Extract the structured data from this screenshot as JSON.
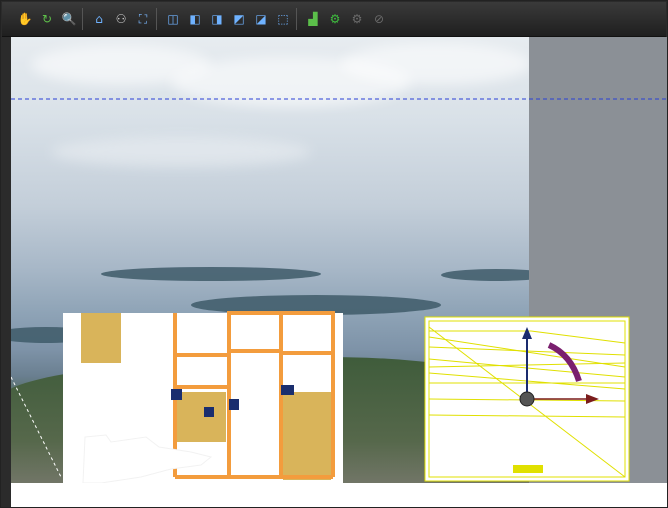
{
  "toolbar": {
    "buttons": [
      {
        "name": "pan-tool-button",
        "icon": "hand-icon",
        "glyph": "✋",
        "color": "#e6e6e6"
      },
      {
        "name": "rotate-tool-button",
        "icon": "rotate-icon",
        "glyph": "↻",
        "color": "#5ec04a"
      },
      {
        "name": "zoom-tool-button",
        "icon": "magnifier-icon",
        "glyph": "🔍",
        "color": "#cfd7e0"
      },
      {
        "name": "home-view-button",
        "icon": "home-icon",
        "glyph": "⌂",
        "color": "#6fb2ff"
      },
      {
        "name": "walk-tool-button",
        "icon": "walk-icon",
        "glyph": "⚇",
        "color": "#d0d0d0"
      },
      {
        "name": "measure-tool-button",
        "icon": "measure-icon",
        "glyph": "⛶",
        "color": "#7ab8ff"
      },
      {
        "name": "front-view-button",
        "icon": "cube-front-icon",
        "glyph": "◫",
        "color": "#6fb2ff"
      },
      {
        "name": "back-view-button",
        "icon": "cube-back-icon",
        "glyph": "◧",
        "color": "#6fb2ff"
      },
      {
        "name": "left-view-button",
        "icon": "cube-left-icon",
        "glyph": "◨",
        "color": "#6fb2ff"
      },
      {
        "name": "right-view-button",
        "icon": "cube-right-icon",
        "glyph": "◩",
        "color": "#6fb2ff"
      },
      {
        "name": "top-view-button",
        "icon": "cube-top-icon",
        "glyph": "◪",
        "color": "#6fb2ff"
      },
      {
        "name": "iso-view-button",
        "icon": "cube-iso-icon",
        "glyph": "⬚",
        "color": "#6fb2ff"
      },
      {
        "name": "background-image-button",
        "icon": "landscape-icon",
        "glyph": "▟",
        "color": "#5bbf4a"
      },
      {
        "name": "settings-button",
        "icon": "gear-green-icon",
        "glyph": "⚙",
        "color": "#3fbf3f"
      },
      {
        "name": "disabled-tool-1-button",
        "icon": "disabled-gear-icon",
        "glyph": "⚙",
        "color": "#6b6b6b"
      },
      {
        "name": "disabled-tool-2-button",
        "icon": "disabled-reset-icon",
        "glyph": "⊘",
        "color": "#6b6b6b"
      }
    ]
  },
  "scene": {
    "guide_line_color": "#2a3fd6",
    "object_frame_color": "#f39c3d",
    "gizmo_box_color": "#e0e000",
    "gizmo_axis_y_color": "#1a2b6e",
    "gizmo_axis_x_color": "#7a1c1c",
    "gizmo_arc_color": "#7a1f6e"
  }
}
